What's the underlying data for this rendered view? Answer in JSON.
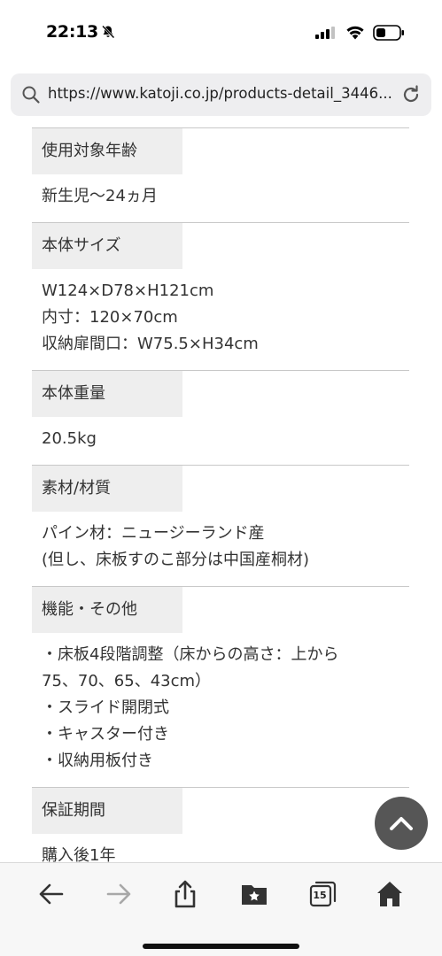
{
  "status_bar": {
    "time": "22:13",
    "icons": [
      "bell-slash-icon",
      "cellular-signal-icon",
      "wifi-icon",
      "battery-icon"
    ]
  },
  "browser": {
    "url": "https://www.katoji.co.jp/products-detail_3446..."
  },
  "specs": [
    {
      "label": "使用対象年齢",
      "lines": [
        "新生児〜24ヵ月"
      ]
    },
    {
      "label": "本体サイズ",
      "lines": [
        "W124×D78×H121cm",
        "内寸：120×70cm",
        "収納扉間口：W75.5×H34cm"
      ]
    },
    {
      "label": "本体重量",
      "lines": [
        "20.5kg"
      ]
    },
    {
      "label": "素材/材質",
      "lines": [
        "パイン材：ニュージーランド産",
        "(但し、床板すのこ部分は中国産桐材)"
      ]
    },
    {
      "label": "機能・その他",
      "lines": [
        "・床板4段階調整（床からの高さ：上から",
        "75、70、65、43cm）",
        "・スライド開閉式",
        "・キャスター付き",
        "・収納用板付き"
      ]
    },
    {
      "label": "保証期間",
      "lines": [
        "購入後1年"
      ]
    }
  ],
  "toolbar": {
    "tabs_count": "15",
    "buttons": [
      "back-icon",
      "forward-icon",
      "share-icon",
      "bookmarks-icon",
      "tabs-icon",
      "home-icon"
    ]
  },
  "colors": {
    "label_bg": "#eeeeee",
    "divider": "#c8c8c8",
    "url_bar_bg": "#eeeef0",
    "scroll_top_bg": "#4a4a4a"
  }
}
